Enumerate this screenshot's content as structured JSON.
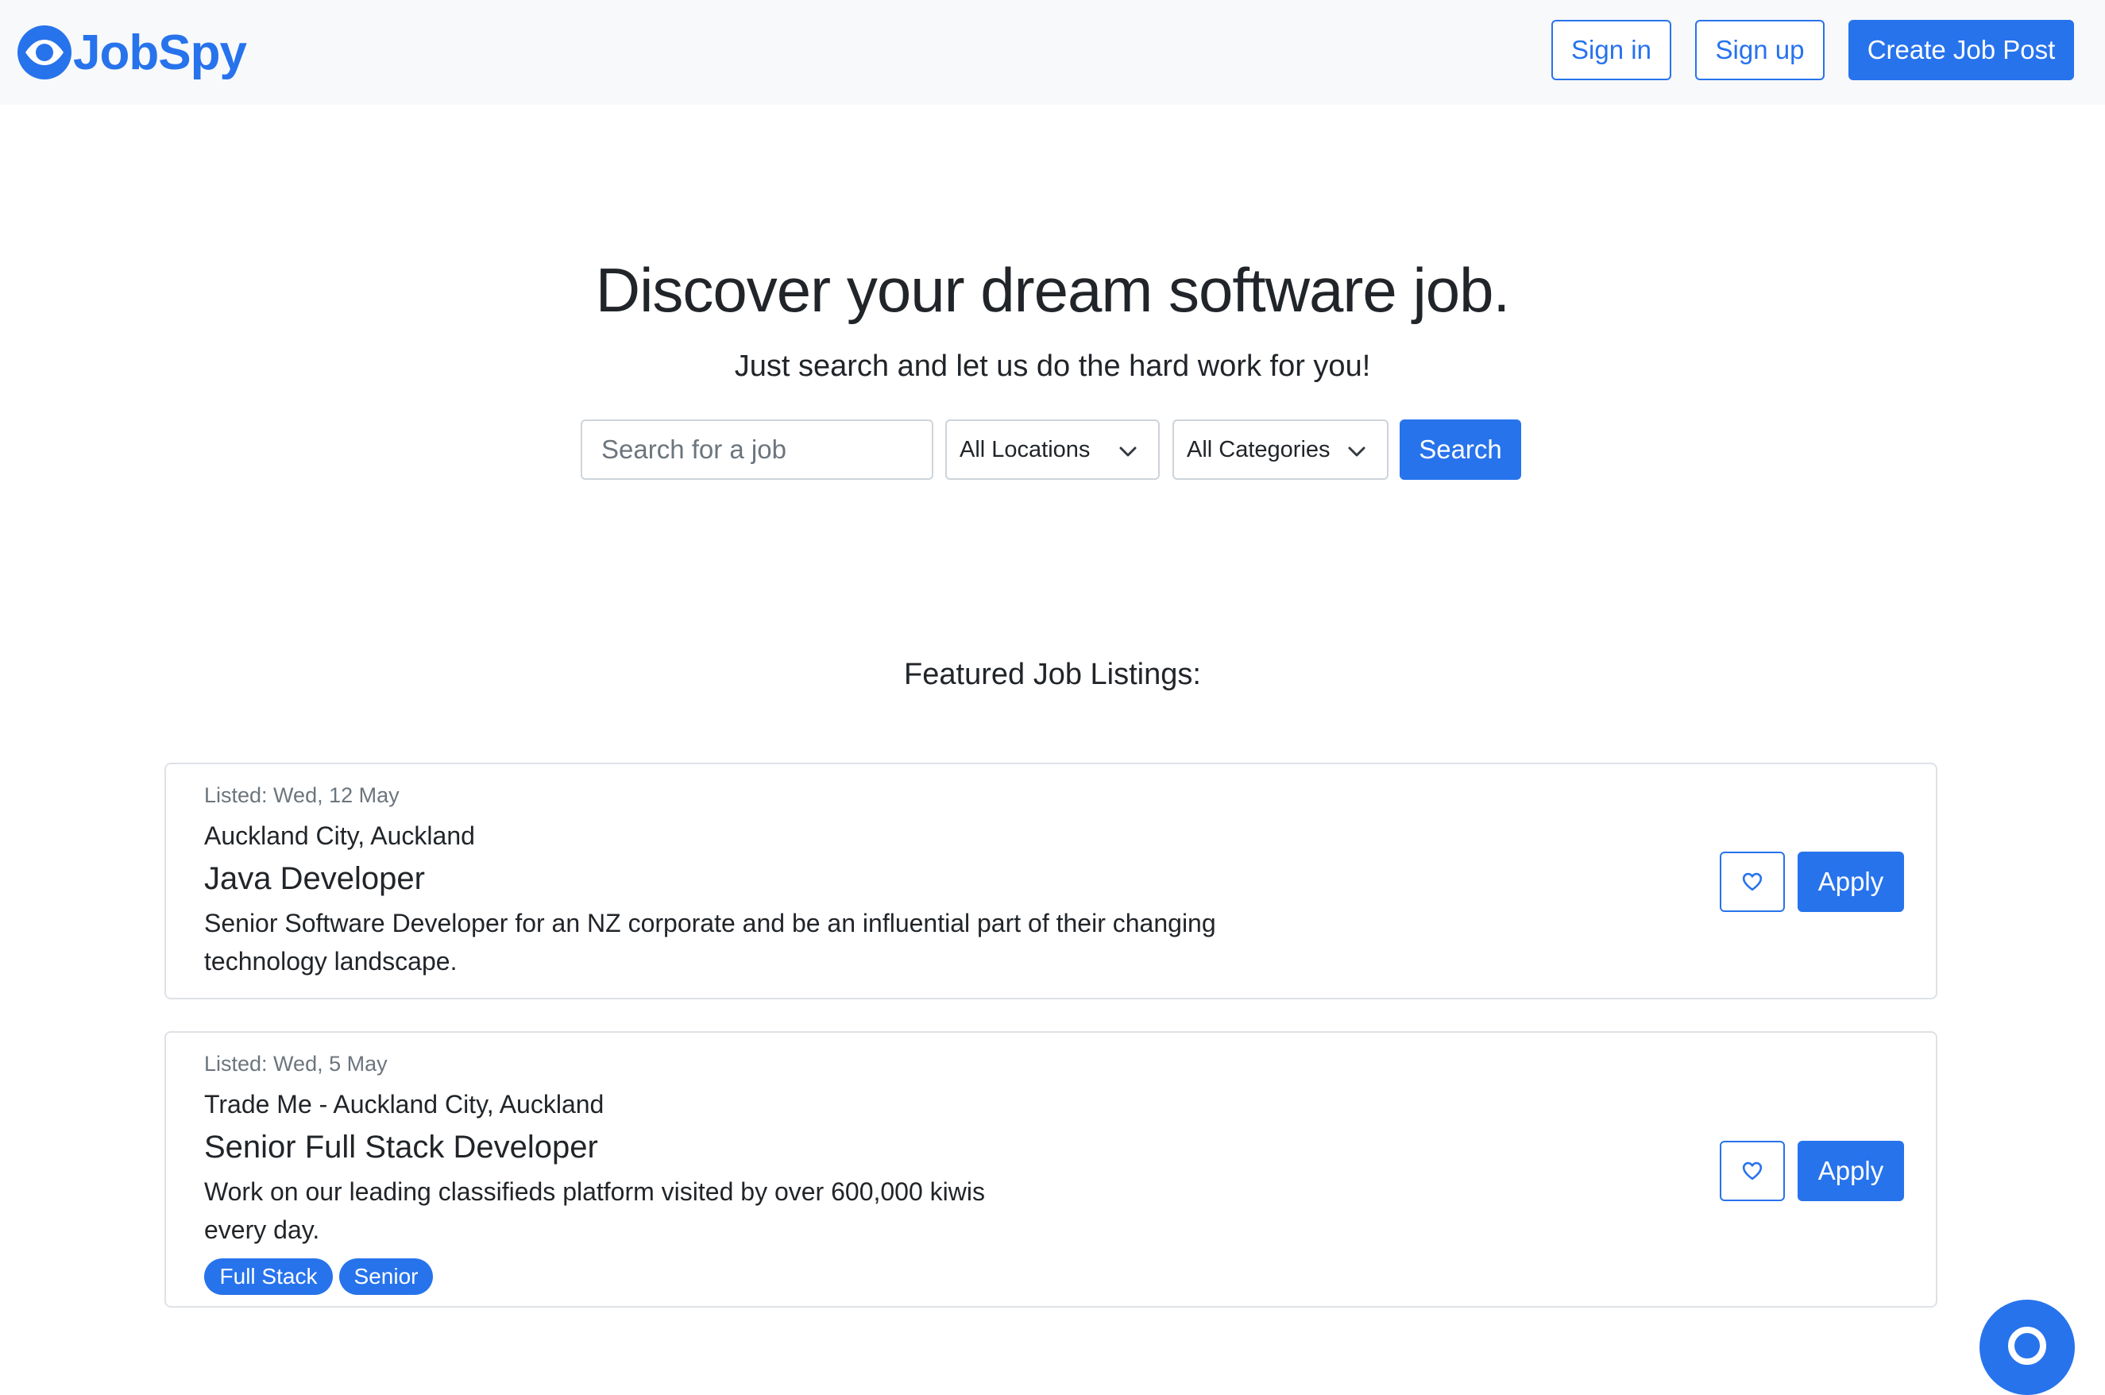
{
  "navbar": {
    "brand": "JobSpy",
    "sign_in": "Sign in",
    "sign_up": "Sign up",
    "create_job_post": "Create Job Post"
  },
  "hero": {
    "title": "Discover your dream software job.",
    "subtitle": "Just search and let us do the hard work for you!",
    "search_placeholder": "Search for a job",
    "search_value": "",
    "location_selected": "All Locations",
    "category_selected": "All Categories",
    "search_button": "Search"
  },
  "featured": {
    "title": "Featured Job Listings:",
    "jobs": [
      {
        "listed": "Listed: Wed, 12 May",
        "location": "Auckland City, Auckland",
        "title": "Java Developer",
        "desc_line1": "Senior Software Developer for an NZ corporate and be an influential part of their changing",
        "desc_line2": "technology landscape.",
        "apply": "Apply",
        "tags": []
      },
      {
        "listed": "Listed: Wed, 5 May",
        "location": "Trade Me - Auckland City, Auckland",
        "title": "Senior Full Stack Developer",
        "desc_line1": "Work on our leading classifieds platform visited by over 600,000 kiwis",
        "desc_line2": "every day.",
        "apply": "Apply",
        "tags": [
          "Full Stack",
          "Senior"
        ]
      }
    ]
  },
  "icons": {
    "brand": "eye-icon",
    "favorite": "heart-icon",
    "dropdown": "chevron-down-icon",
    "help": "help-icon"
  },
  "colors": {
    "primary": "#2773ec",
    "navbar_bg": "#f8f9fa",
    "text": "#212529",
    "muted": "#6c757d",
    "border": "#dee2e6"
  }
}
